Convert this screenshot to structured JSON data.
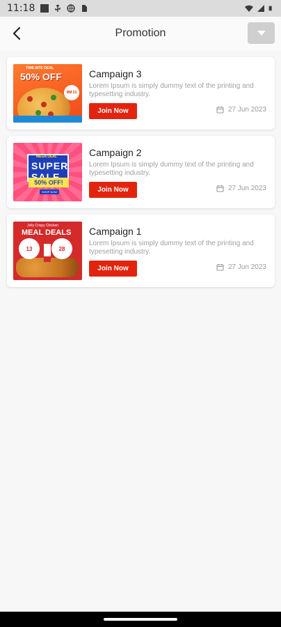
{
  "status_bar": {
    "time": "11:18"
  },
  "header": {
    "title": "Promotion"
  },
  "campaigns": [
    {
      "title": "Campaign 3",
      "description": "Lorem Ipsum is simply dummy text of the printing and typesetting industry.",
      "button": "Join Now",
      "date": "27 Jun 2023",
      "thumb": {
        "kind": "pizza",
        "tag": "TIME-BITE DEAL",
        "headline": "50% OFF",
        "badge": "RM 21"
      }
    },
    {
      "title": "Campaign 2",
      "description": "Lorem Ipsum is simply dummy text of the printing and typesetting industry.",
      "button": "Join Now",
      "date": "27 Jun 2023",
      "thumb": {
        "kind": "sale",
        "kicker": "MEGA DEAL",
        "headline": "SUPER SALE",
        "offer": "50% OFF!",
        "cta": "SHOP NOW"
      }
    },
    {
      "title": "Campaign 1",
      "description": "Lorem Ipsum is simply dummy text of the printing and typesetting industry.",
      "button": "Join Now",
      "date": "27 Jun 2023",
      "thumb": {
        "kind": "meal",
        "kicker": "Jolly Crispy Chicken",
        "headline": "MEAL DEALS",
        "price1": "13",
        "price2": "28"
      }
    }
  ],
  "colors": {
    "accent": "#e2240f",
    "background": "#f7f7f7"
  },
  "icons": {
    "back": "arrow-left-icon",
    "filter": "chevron-down-icon",
    "date": "calendar-icon"
  }
}
